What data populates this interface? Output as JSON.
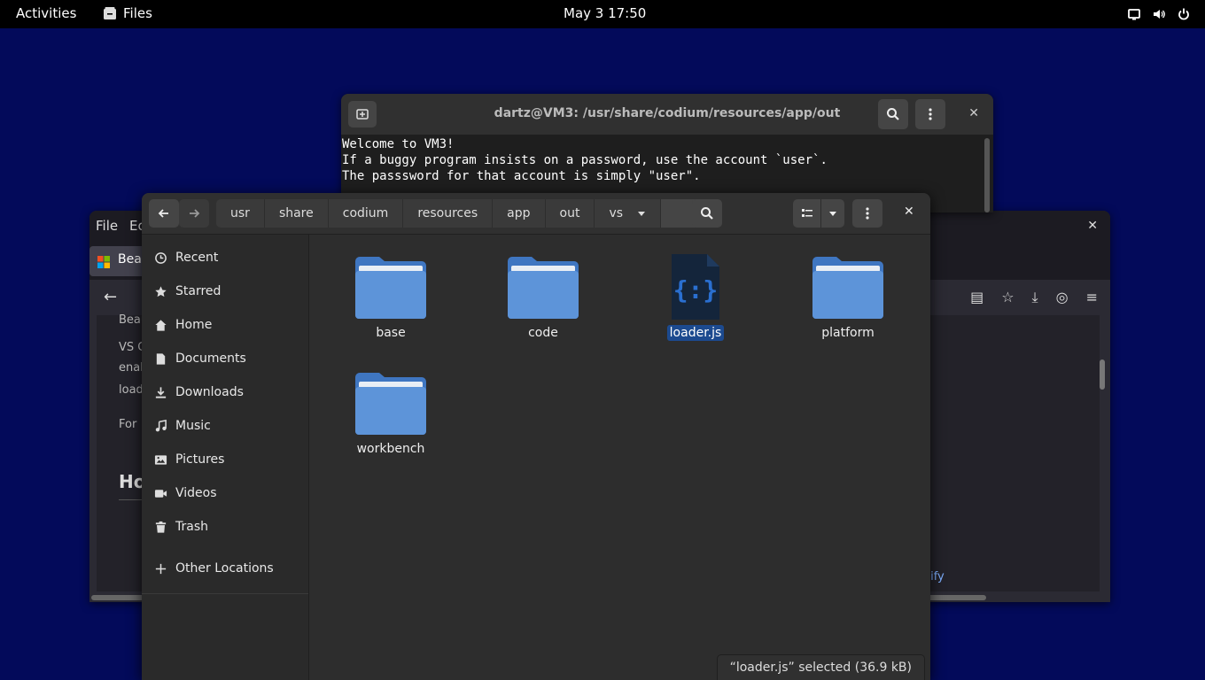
{
  "topbar": {
    "activities": "Activities",
    "app_name": "Files",
    "clock": "May 3  17:50"
  },
  "browser": {
    "menu": [
      "File",
      "Ec"
    ],
    "tab_title": "Bea",
    "content_lines": [
      "Beau",
      "VS C",
      "enab",
      "load",
      "For"
    ],
    "heading": "Ho",
    "footer_link": "tify"
  },
  "terminal": {
    "title": "dartz@VM3: /usr/share/codium/resources/app/out",
    "lines": [
      "Welcome to VM3!",
      "If a buggy program insists on a password, use the account `user`.",
      "The passsword for that account is simply \"user\"."
    ]
  },
  "files": {
    "path": [
      "usr",
      "share",
      "codium",
      "resources",
      "app",
      "out",
      "vs"
    ],
    "sidebar": [
      {
        "label": "Recent",
        "icon": "clock-icon"
      },
      {
        "label": "Starred",
        "icon": "star-icon"
      },
      {
        "label": "Home",
        "icon": "home-icon"
      },
      {
        "label": "Documents",
        "icon": "document-icon"
      },
      {
        "label": "Downloads",
        "icon": "download-icon"
      },
      {
        "label": "Music",
        "icon": "music-icon"
      },
      {
        "label": "Pictures",
        "icon": "pictures-icon"
      },
      {
        "label": "Videos",
        "icon": "video-icon"
      },
      {
        "label": "Trash",
        "icon": "trash-icon"
      }
    ],
    "other_locations": "Other Locations",
    "items": [
      {
        "name": "base",
        "type": "folder"
      },
      {
        "name": "code",
        "type": "folder"
      },
      {
        "name": "loader.js",
        "type": "javascript-file",
        "selected": true
      },
      {
        "name": "platform",
        "type": "folder"
      },
      {
        "name": "workbench",
        "type": "folder"
      }
    ],
    "status": "“loader.js” selected  (36.9 kB)"
  },
  "colors": {
    "desktop": "#030a5a",
    "folder": "#5d94d9",
    "selection": "#1c4a8f"
  }
}
